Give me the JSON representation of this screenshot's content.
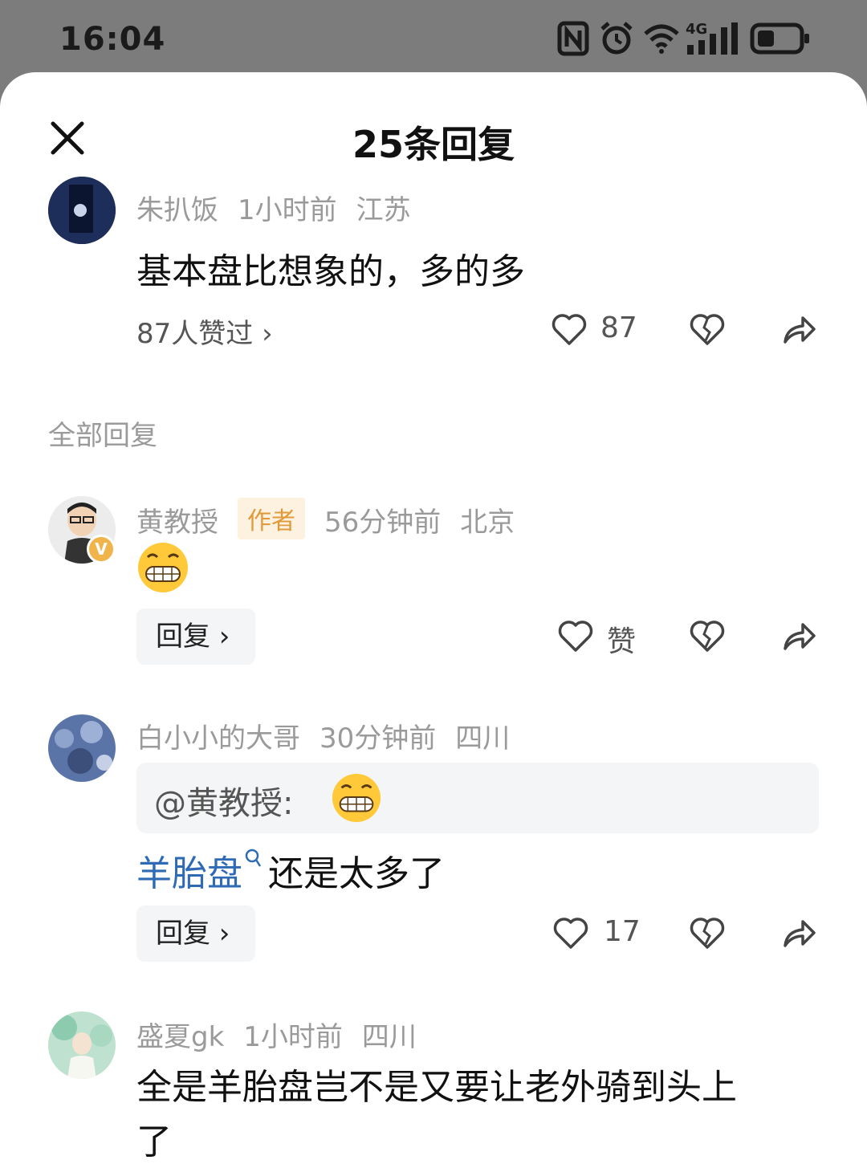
{
  "status": {
    "time": "16:04"
  },
  "sheet": {
    "title": "25条回复"
  },
  "main_comment": {
    "user": "朱扒饭",
    "time": "1小时前",
    "location": "江苏",
    "text": "基本盘比想象的，多的多",
    "likes_summary": "87人赞过 ›",
    "like_count": "87"
  },
  "section_label": "全部回复",
  "replies": [
    {
      "user": "黄教授",
      "tag": "作者",
      "time": "56分钟前",
      "location": "北京",
      "reply_label": "回复 ›",
      "like_label": "赞"
    },
    {
      "user": "白小小的大哥",
      "time": "30分钟前",
      "location": "四川",
      "quote": "@黄教授:",
      "link": "羊胎盘",
      "text": "还是太多了",
      "reply_label": "回复 ›",
      "like_count": "17"
    },
    {
      "user": "盛夏gk",
      "time": "1小时前",
      "location": "四川",
      "text_line1": "全是羊胎盘岂不是又要让老外骑到头上",
      "text_line2": "了"
    }
  ],
  "colors": {
    "accent": "#2f6bb5",
    "author_tag": "#e19a3b"
  }
}
